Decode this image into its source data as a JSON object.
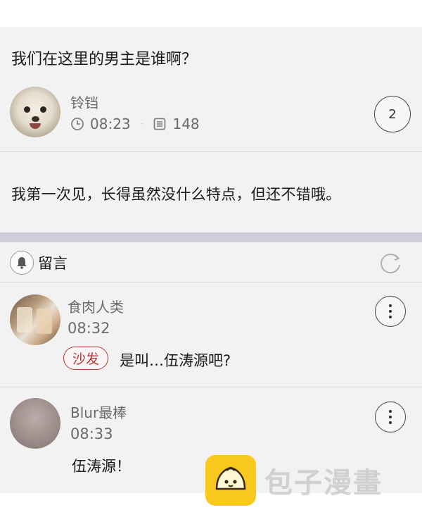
{
  "post": {
    "title": "我们在这里的男主是谁啊？",
    "author": "铃铛",
    "time": "08:23",
    "views": "148",
    "reply_count": "2",
    "body": "我第一次见，长得虽然没什么特点，但还不错哦。"
  },
  "comments_section": {
    "title": "留言",
    "icons": {
      "section": "bell-icon",
      "refresh": "refresh-icon"
    }
  },
  "comments": [
    {
      "author": "食肉人类",
      "time": "08:32",
      "badge": "沙发",
      "text": "是叫…伍涛源吧?"
    },
    {
      "author": "Blur最棒",
      "time": "08:33",
      "text": "伍涛源！"
    }
  ],
  "watermark": {
    "text": "包子漫畫"
  },
  "colors": {
    "badge": "#b13a3a",
    "separator_band": "#cfcfdc",
    "logo": "#f8c91c"
  }
}
